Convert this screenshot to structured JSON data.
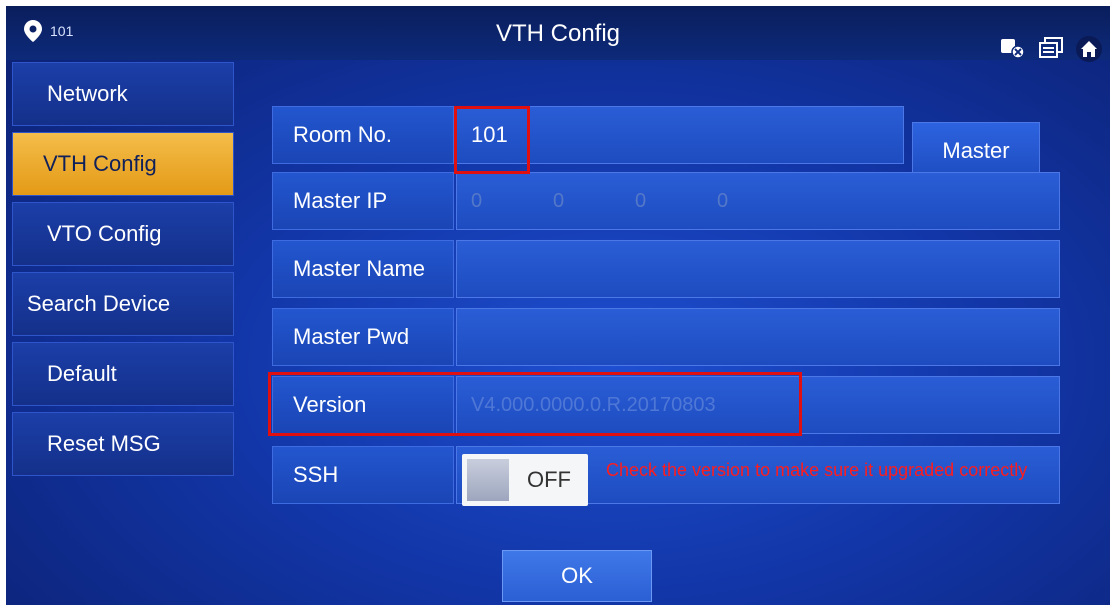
{
  "header": {
    "location": "101",
    "title": "VTH Config"
  },
  "sidebar": {
    "items": [
      {
        "label": "Network"
      },
      {
        "label": "VTH Config",
        "active": true
      },
      {
        "label": "VTO Config"
      },
      {
        "label": "Search Device"
      },
      {
        "label": "Default"
      },
      {
        "label": "Reset MSG"
      }
    ]
  },
  "form": {
    "room_no": {
      "label": "Room No.",
      "value": "101"
    },
    "master_button": "Master",
    "master_ip": {
      "label": "Master IP",
      "octets": [
        "0",
        "0",
        "0",
        "0"
      ]
    },
    "master_name": {
      "label": "Master Name",
      "value": ""
    },
    "master_pwd": {
      "label": "Master Pwd",
      "value": ""
    },
    "version": {
      "label": "Version",
      "value": "V4.000.0000.0.R.20170803"
    },
    "ssh": {
      "label": "SSH",
      "state": "OFF"
    }
  },
  "ok_button": "OK",
  "annotation": {
    "text": "Check the version to make sure it upgraded correctly",
    "color": "#ff1c1c"
  },
  "colors": {
    "active_tab": "#f4bd4a",
    "background": "#1236a8",
    "highlight_box": "#e01010"
  },
  "icons": [
    "location-pin-icon",
    "network-status-icon",
    "windows-icon",
    "home-icon"
  ]
}
